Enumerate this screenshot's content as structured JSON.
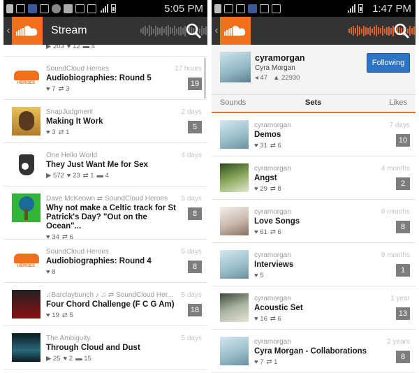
{
  "left": {
    "status_time": "5:05 PM",
    "title": "Stream",
    "top_stats": [
      "▶ 203",
      "♥ 12",
      "▬ 4"
    ],
    "items": [
      {
        "user": "SoundCloud Heroes",
        "title": "Audiobiographies: Round 5",
        "ago": "17 hours",
        "badge": "19",
        "stats": [
          "♥ 7",
          "⇄ 3"
        ],
        "thumb": "heroes"
      },
      {
        "user": "SnapJudgment",
        "title": "Making It Work",
        "ago": "2 days",
        "badge": "5",
        "stats": [
          "♥ 3",
          "⇄ 1"
        ],
        "thumb": "snap"
      },
      {
        "user": "One Hello World",
        "title": "They Just Want Me for Sex",
        "ago": "4 days",
        "badge": "",
        "stats": [
          "▶ 572",
          "♥ 23",
          "⇄ 1",
          "▬ 4"
        ],
        "thumb": "hello"
      },
      {
        "user": "Dave McKeown ⇄ SoundCloud Heroes",
        "title": "Why not make a Celtic track for St Patrick's Day? \"Out on the Ocean\"...",
        "ago": "5 days",
        "badge": "8",
        "stats": [
          "♥ 34",
          "⇄ 6"
        ],
        "thumb": "celtic"
      },
      {
        "user": "SoundCloud Heroes",
        "title": "Audiobiographies: Round 4",
        "ago": "5 days",
        "badge": "8",
        "stats": [
          "♥ 8"
        ],
        "thumb": "heroes"
      },
      {
        "user": "♫Barclaybunch ♪ ♫ ⇄ SoundCloud Her...",
        "title": "Four Chord Challenge (F C G Am)",
        "ago": "5 days",
        "badge": "18",
        "stats": [
          "♥ 19",
          "⇄ 5"
        ],
        "thumb": "barclay"
      },
      {
        "user": "The Ambiguity.",
        "title": "Through Cloud and Dust",
        "ago": "5 days",
        "badge": "",
        "stats": [
          "▶ 25",
          "♥ 2",
          "▬ 15"
        ],
        "thumb": "ambig"
      }
    ]
  },
  "right": {
    "status_time": "1:47 PM",
    "profile": {
      "username": "cyramorgan",
      "name": "Cyra Morgan",
      "followers": "◂ 47",
      "following": "▲ 22930",
      "follow_label": "Following"
    },
    "tabs": [
      "Sounds",
      "Sets",
      "Likes"
    ],
    "sets": [
      {
        "user": "cyramorgan",
        "title": "Demos",
        "ago": "7 days",
        "badge": "10",
        "stats": [
          "♥ 31",
          "⇄ 6"
        ],
        "thumb": "cyra1"
      },
      {
        "user": "cyramorgan",
        "title": "Angst",
        "ago": "4 months",
        "badge": "2",
        "stats": [
          "♥ 29",
          "⇄ 8"
        ],
        "thumb": "cyra2"
      },
      {
        "user": "cyramorgan",
        "title": "Love Songs",
        "ago": "6 months",
        "badge": "8",
        "stats": [
          "♥ 61",
          "⇄ 6"
        ],
        "thumb": "cyra3"
      },
      {
        "user": "cyramorgan",
        "title": "Interviews",
        "ago": "9 months",
        "badge": "1",
        "stats": [
          "♥ 5"
        ],
        "thumb": "cyra1"
      },
      {
        "user": "cyramorgan",
        "title": "Acoustic Set",
        "ago": "1 year",
        "badge": "13",
        "stats": [
          "♥ 16",
          "⇄ 6"
        ],
        "thumb": "cyra4"
      },
      {
        "user": "cyramorgan",
        "title": "Cyra Morgan - Collaborations",
        "ago": "2 years",
        "badge": "8",
        "stats": [
          "♥ 7",
          "⇄ 1"
        ],
        "thumb": "cyra1"
      }
    ]
  }
}
